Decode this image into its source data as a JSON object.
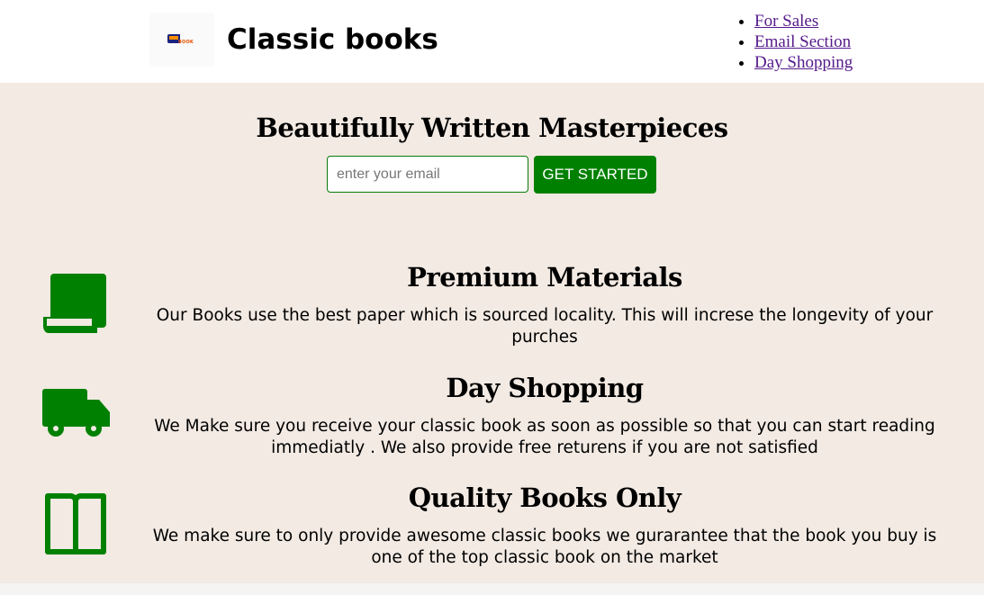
{
  "header": {
    "logo_text": "BOOK",
    "title": "Classic books",
    "nav": [
      {
        "label": "For Sales"
      },
      {
        "label": "Email Section"
      },
      {
        "label": "Day Shopping"
      }
    ]
  },
  "hero": {
    "title": "Beautifully Written Masterpieces",
    "email_placeholder": "enter your email",
    "email_value": "",
    "button_label": "GET STARTED"
  },
  "features": [
    {
      "icon": "book-icon",
      "title": "Premium Materials",
      "text": "Our Books use the best paper which is sourced locality. This will increse the longevity of your purches"
    },
    {
      "icon": "truck-icon",
      "title": "Day Shopping",
      "text": "We Make sure you receive your classic book as soon as possible so that you can start reading immediatly . We also provide free returens if you are not satisfied"
    },
    {
      "icon": "open-book-icon",
      "title": "Quality Books Only",
      "text": "We make sure to only provide awesome classic books we gurarantee that the book you buy is one of the top classic book on the market"
    }
  ],
  "colors": {
    "accent": "#008000",
    "section_bg": "#f2eae3",
    "header_bg": "#ffffff",
    "link": "#551a8b"
  }
}
